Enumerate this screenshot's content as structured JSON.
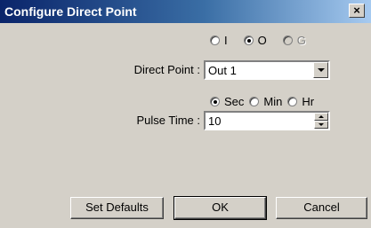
{
  "window": {
    "title": "Configure Direct Point",
    "close_label": "×"
  },
  "point_type": {
    "options": [
      {
        "label": "I",
        "checked": false,
        "disabled": false
      },
      {
        "label": "O",
        "checked": true,
        "disabled": false
      },
      {
        "label": "G",
        "checked": false,
        "disabled": true
      }
    ]
  },
  "direct_point": {
    "label": "Direct Point :",
    "value": "Out 1"
  },
  "time_unit": {
    "options": [
      {
        "label": "Sec",
        "checked": true
      },
      {
        "label": "Min",
        "checked": false
      },
      {
        "label": "Hr",
        "checked": false
      }
    ]
  },
  "pulse_time": {
    "label": "Pulse Time :",
    "value": "10"
  },
  "buttons": {
    "set_defaults": "Set Defaults",
    "ok": "OK",
    "cancel": "Cancel"
  }
}
